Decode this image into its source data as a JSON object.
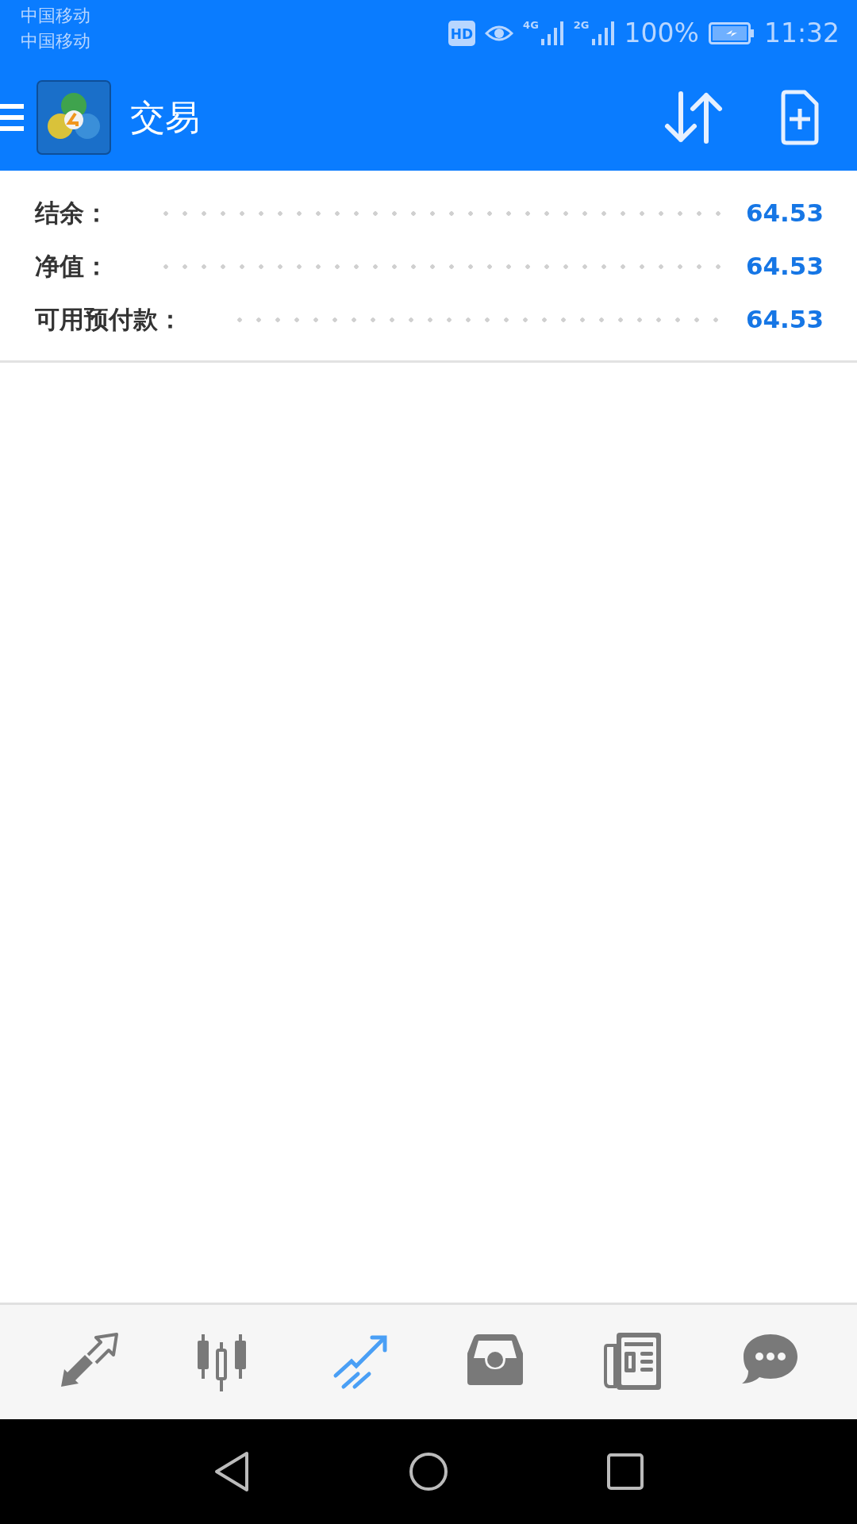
{
  "status_bar": {
    "carriers": [
      "中国移动",
      "中国移动"
    ],
    "hd": "HD",
    "networks": [
      "4G",
      "2G"
    ],
    "battery": "100%",
    "time": "11:32"
  },
  "app_bar": {
    "title": "交易"
  },
  "account": [
    {
      "label": "结余：",
      "value": "64.53"
    },
    {
      "label": "净值：",
      "value": "64.53"
    },
    {
      "label": "可用预付款：",
      "value": "64.53"
    }
  ],
  "bottom_nav": [
    {
      "selected": false
    },
    {
      "selected": false
    },
    {
      "selected": true
    },
    {
      "selected": false
    },
    {
      "selected": false
    },
    {
      "selected": false
    }
  ]
}
